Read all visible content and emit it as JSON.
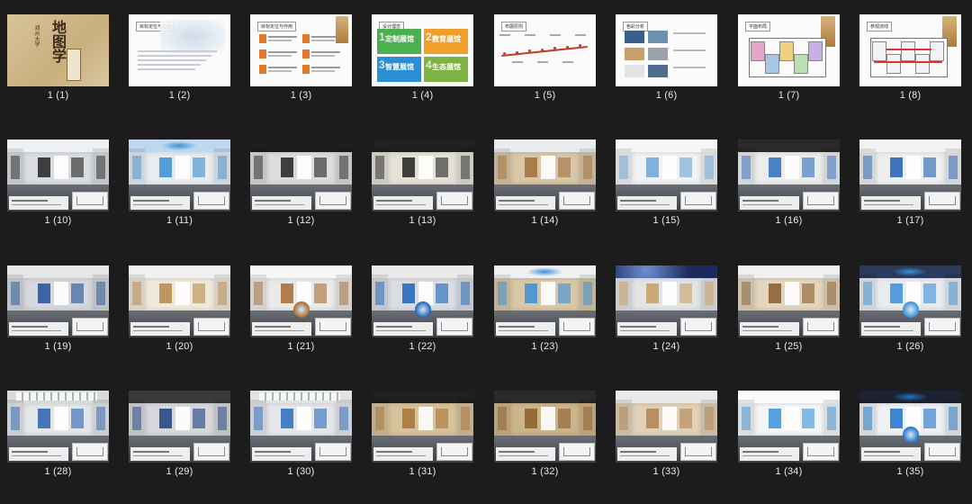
{
  "slides": [
    {
      "label": "1 (1)",
      "kind": "cover",
      "title": "地图学",
      "subtitle": "郑州大学"
    },
    {
      "label": "1 (2)",
      "kind": "text",
      "heading": "目标定位与作用"
    },
    {
      "label": "1 (3)",
      "kind": "textgrid",
      "heading": "目标定位与作用"
    },
    {
      "label": "1 (4)",
      "kind": "concept",
      "heading": "设计理念",
      "cells": [
        "定制展馆",
        "教育展馆",
        "智慧展馆",
        "生态展馆"
      ]
    },
    {
      "label": "1 (5)",
      "kind": "timeline",
      "heading": "布展原则"
    },
    {
      "label": "1 (6)",
      "kind": "colors",
      "heading": "色彩分析"
    },
    {
      "label": "1 (7)",
      "kind": "plan",
      "heading": "平面布局"
    },
    {
      "label": "1 (8)",
      "kind": "plan2",
      "heading": "参观流线"
    },
    {
      "label": "1 (10)",
      "kind": "room",
      "theme": "lobby"
    },
    {
      "label": "1 (11)",
      "kind": "room",
      "theme": "blueceil"
    },
    {
      "label": "1 (12)",
      "kind": "room",
      "theme": "hall"
    },
    {
      "label": "1 (13)",
      "kind": "room",
      "theme": "hall2"
    },
    {
      "label": "1 (14)",
      "kind": "room",
      "theme": "wood"
    },
    {
      "label": "1 (15)",
      "kind": "room",
      "theme": "white"
    },
    {
      "label": "1 (16)",
      "kind": "room",
      "theme": "screen"
    },
    {
      "label": "1 (17)",
      "kind": "room",
      "theme": "meeting"
    },
    {
      "label": "1 (19)",
      "kind": "room",
      "theme": "corridor"
    },
    {
      "label": "1 (20)",
      "kind": "room",
      "theme": "map"
    },
    {
      "label": "1 (21)",
      "kind": "room",
      "theme": "round"
    },
    {
      "label": "1 (22)",
      "kind": "room",
      "theme": "globe"
    },
    {
      "label": "1 (23)",
      "kind": "room",
      "theme": "ring"
    },
    {
      "label": "1 (24)",
      "kind": "room",
      "theme": "stars"
    },
    {
      "label": "1 (25)",
      "kind": "room",
      "theme": "wood2"
    },
    {
      "label": "1 (26)",
      "kind": "room",
      "theme": "dome"
    },
    {
      "label": "1 (28)",
      "kind": "room",
      "theme": "panels"
    },
    {
      "label": "1 (29)",
      "kind": "room",
      "theme": "dark"
    },
    {
      "label": "1 (30)",
      "kind": "room",
      "theme": "hex"
    },
    {
      "label": "1 (31)",
      "kind": "room",
      "theme": "warm"
    },
    {
      "label": "1 (32)",
      "kind": "room",
      "theme": "warm2"
    },
    {
      "label": "1 (33)",
      "kind": "room",
      "theme": "stripes"
    },
    {
      "label": "1 (34)",
      "kind": "room",
      "theme": "bright"
    },
    {
      "label": "1 (35)",
      "kind": "room",
      "theme": "earth"
    }
  ],
  "colors": {
    "background": "#1c1c1c",
    "caption": "#e8e8e8",
    "accent_green": "#4caf50",
    "accent_orange": "#f0a02a",
    "accent_blue": "#2a8fd6",
    "accent_lime": "#7cb342"
  }
}
